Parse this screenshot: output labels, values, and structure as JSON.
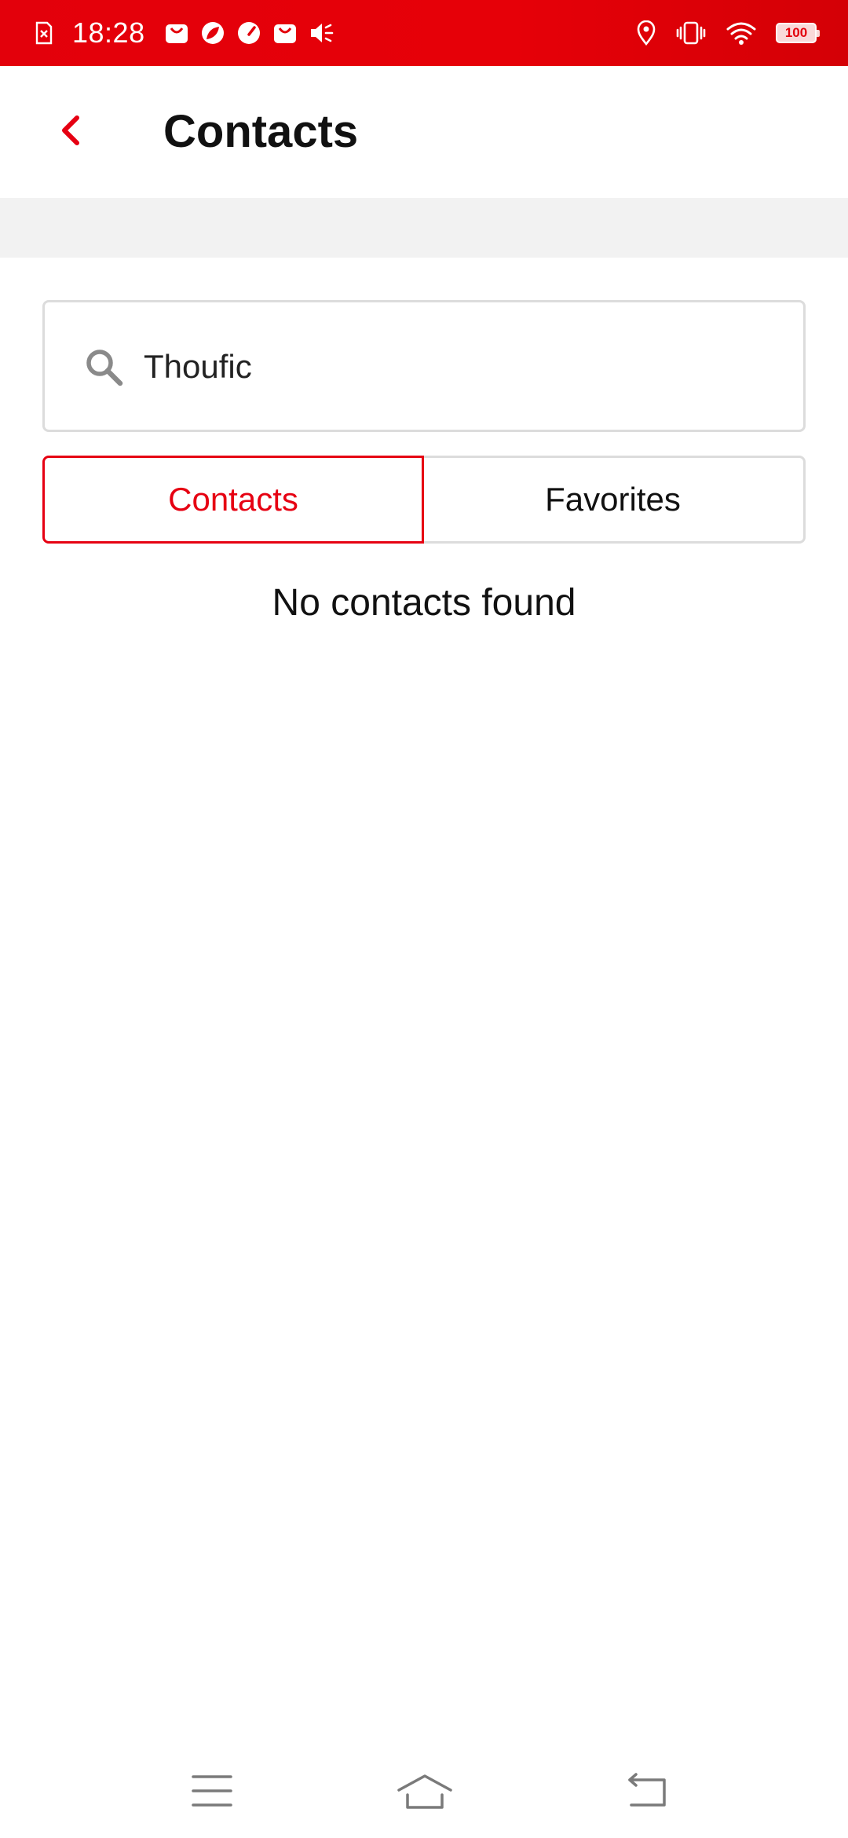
{
  "status_bar": {
    "time": "18:28",
    "battery_level": "100",
    "left_icons": [
      "sim-error-icon",
      "shopping-bag-icon",
      "leaf-app-icon",
      "speedometer-icon",
      "shopping-bag-icon",
      "speaker-mute-icon"
    ],
    "right_icons": [
      "location-icon",
      "vibrate-icon",
      "wifi-icon",
      "battery-icon"
    ],
    "background_color": "#e3000b"
  },
  "header": {
    "title": "Contacts",
    "back_icon": "chevron-left-icon",
    "accent_color": "#e60012"
  },
  "search": {
    "value": "Thoufic",
    "icon": "search-icon"
  },
  "tabs": [
    {
      "label": "Contacts",
      "selected": true
    },
    {
      "label": "Favorites",
      "selected": false
    }
  ],
  "empty_state": {
    "message": "No contacts found"
  },
  "nav_bar": {
    "items": [
      "menu-icon",
      "home-icon",
      "back-icon"
    ]
  }
}
